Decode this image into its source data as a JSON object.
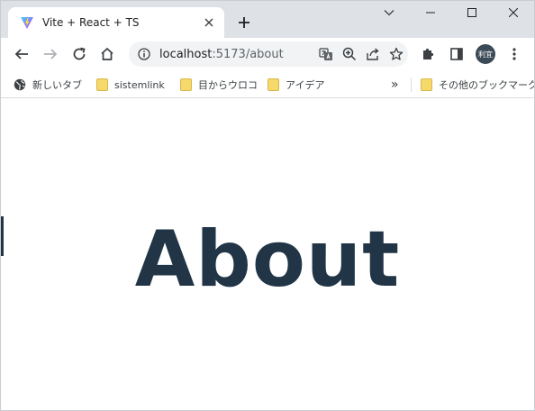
{
  "browser": {
    "tab": {
      "title": "Vite + React + TS"
    },
    "address": {
      "host": "localhost",
      "rest": ":5173/about"
    },
    "profile": {
      "initials": "利宜"
    },
    "bookmarks": [
      {
        "label": "新しいタブ",
        "icon": "globe-icon"
      },
      {
        "label": "sistemlink",
        "icon": "folder-icon"
      },
      {
        "label": "目からウロコ",
        "icon": "folder-icon"
      },
      {
        "label": "アイデア",
        "icon": "folder-icon"
      }
    ],
    "other_bookmarks": {
      "label": "その他のブックマーク",
      "icon": "folder-icon"
    },
    "overflow_label": "»"
  },
  "page": {
    "heading": "About"
  },
  "colors": {
    "heading": "#213547",
    "tabstrip": "#dee1e6",
    "folder": "#f6d96b"
  }
}
